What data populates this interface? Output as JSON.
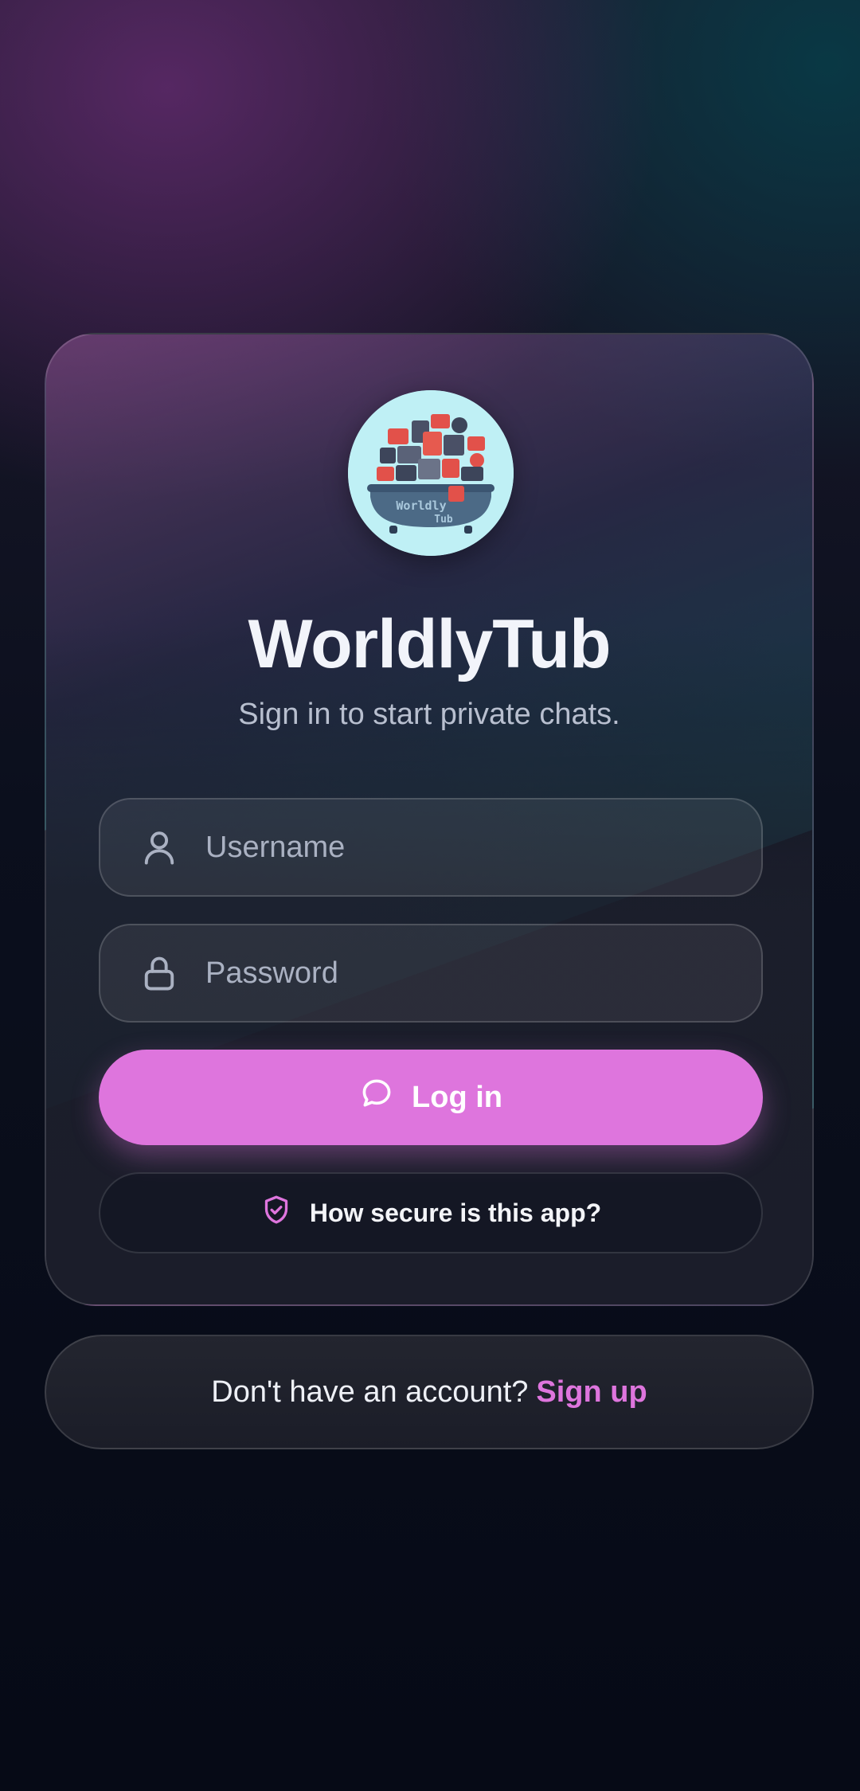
{
  "app": {
    "name": "WorldlyTub",
    "tagline": "Sign in to start private chats.",
    "logo_text_line1": "Worldly",
    "logo_text_line2": "Tub"
  },
  "form": {
    "username": {
      "placeholder": "Username",
      "value": "",
      "icon": "user-icon"
    },
    "password": {
      "placeholder": "Password",
      "value": "",
      "icon": "lock-icon"
    },
    "login_label": "Log in",
    "login_icon": "chat-bubble-icon",
    "security_label": "How secure is this app?",
    "security_icon": "shield-check-icon"
  },
  "footer": {
    "prompt": "Don't have an account?",
    "signup_label": "Sign up"
  },
  "colors": {
    "accent": "#de75dd",
    "background_top_left": "#602a6c",
    "background_top_right": "#083a46",
    "background_bottom": "#060a16"
  }
}
